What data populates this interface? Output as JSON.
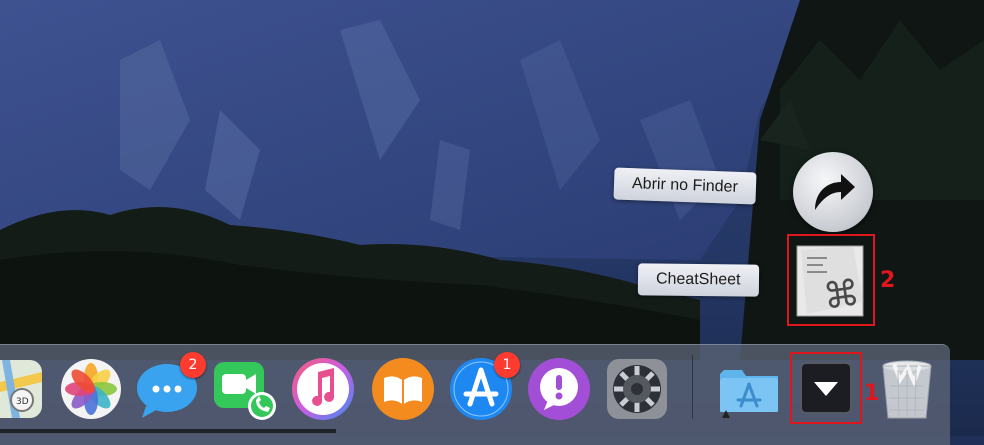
{
  "stack_popup": {
    "open_in_finder_label": "Abrir no Finder",
    "cheatsheet_label": "CheatSheet",
    "open_icon": "curved-arrow-icon",
    "app_icon": "command-sheet-icon"
  },
  "annotations": {
    "step_one": "1",
    "step_two": "2",
    "highlight_color": "#e0161f"
  },
  "dock": {
    "apps": [
      {
        "icon": "maps-icon"
      },
      {
        "icon": "photos-icon"
      },
      {
        "icon": "messages-icon",
        "badge": "2"
      },
      {
        "icon": "facetime-icon"
      },
      {
        "icon": "itunes-icon"
      },
      {
        "icon": "ibooks-icon"
      },
      {
        "icon": "app-store-icon",
        "badge": "1"
      },
      {
        "icon": "feedback-assistant-icon"
      },
      {
        "icon": "system-preferences-icon"
      },
      {
        "icon": "applications-folder-icon"
      },
      {
        "icon": "stack-toggle-icon"
      },
      {
        "icon": "trash-icon"
      }
    ],
    "badge_color": "#ff3b30"
  }
}
